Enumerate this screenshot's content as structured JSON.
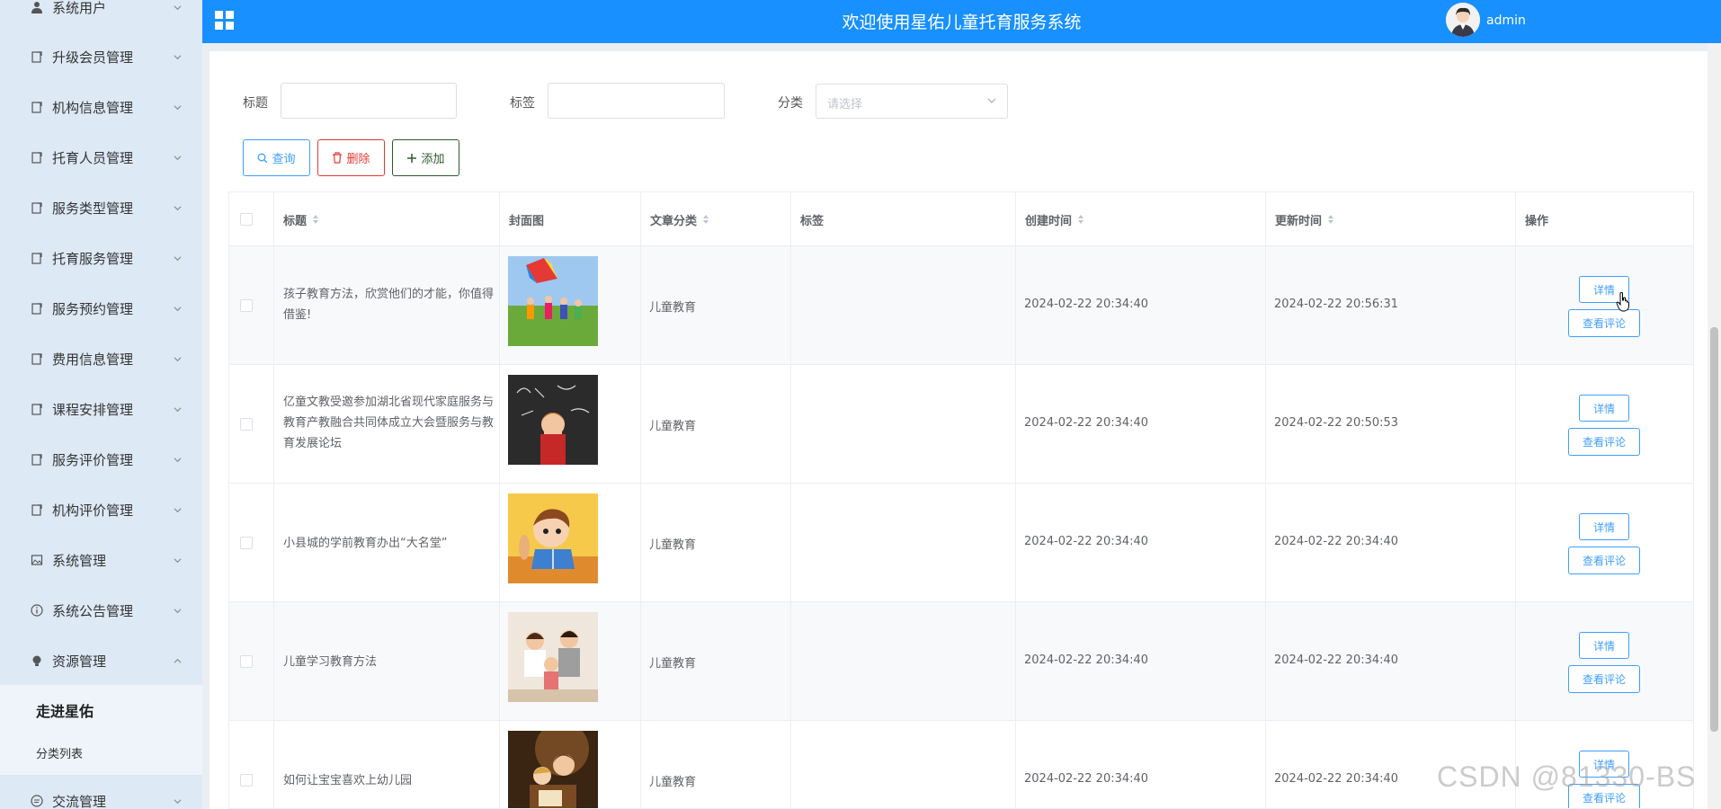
{
  "header": {
    "title": "欢迎使用星佑儿童托育服务系统",
    "user": "admin",
    "bg_color": "#1890ff"
  },
  "sidebar": {
    "items": [
      {
        "label": "系统用户",
        "icon": "user-icon",
        "expanded": false
      },
      {
        "label": "升级会员管理",
        "icon": "doc-icon",
        "expanded": false
      },
      {
        "label": "机构信息管理",
        "icon": "doc-icon",
        "expanded": false
      },
      {
        "label": "托育人员管理",
        "icon": "doc-icon",
        "expanded": false
      },
      {
        "label": "服务类型管理",
        "icon": "doc-icon",
        "expanded": false
      },
      {
        "label": "托育服务管理",
        "icon": "doc-icon",
        "expanded": false
      },
      {
        "label": "服务预约管理",
        "icon": "doc-icon",
        "expanded": false
      },
      {
        "label": "费用信息管理",
        "icon": "doc-icon",
        "expanded": false
      },
      {
        "label": "课程安排管理",
        "icon": "doc-icon",
        "expanded": false
      },
      {
        "label": "服务评价管理",
        "icon": "doc-icon",
        "expanded": false
      },
      {
        "label": "机构评价管理",
        "icon": "doc-icon",
        "expanded": false
      },
      {
        "label": "系统管理",
        "icon": "image-icon",
        "expanded": false
      },
      {
        "label": "系统公告管理",
        "icon": "info-icon",
        "expanded": false
      },
      {
        "label": "资源管理",
        "icon": "bulb-icon",
        "expanded": true
      },
      {
        "label": "交流管理",
        "icon": "chat-icon",
        "expanded": false
      }
    ],
    "submenu": {
      "active": "走进星佑",
      "other": "分类列表"
    }
  },
  "filters": {
    "title_label": "标题",
    "tag_label": "标签",
    "category_label": "分类",
    "title_value": "",
    "tag_value": "",
    "category_placeholder": "请选择"
  },
  "actions": {
    "query": "查询",
    "delete": "删除",
    "add": "添加"
  },
  "table": {
    "columns": {
      "title": "标题",
      "cover": "封面图",
      "category": "文章分类",
      "tags": "标签",
      "created": "创建时间",
      "updated": "更新时间",
      "ops": "操作"
    },
    "detail_label": "详情",
    "comment_label": "查看评论",
    "rows": [
      {
        "title": "孩子教育方法，欣赏他们的才能，你值得借鉴!",
        "category": "儿童教育",
        "tags": "",
        "created": "2024-02-22 20:34:40",
        "updated": "2024-02-22 20:56:31",
        "cover": "kids-kite"
      },
      {
        "title": "亿童文教受邀参加湖北省现代家庭服务与教育产教融合共同体成立大会暨服务与教育发展论坛",
        "category": "儿童教育",
        "tags": "",
        "created": "2024-02-22 20:34:40",
        "updated": "2024-02-22 20:50:53",
        "cover": "chalkboard-boy"
      },
      {
        "title": "小县城的学前教育办出“大名堂”",
        "category": "儿童教育",
        "tags": "",
        "created": "2024-02-22 20:34:40",
        "updated": "2024-02-22 20:34:40",
        "cover": "cartoon-reading"
      },
      {
        "title": "儿童学习教育方法",
        "category": "儿童教育",
        "tags": "",
        "created": "2024-02-22 20:34:40",
        "updated": "2024-02-22 20:34:40",
        "cover": "family"
      },
      {
        "title": "如何让宝宝喜欢上幼儿园",
        "category": "儿童教育",
        "tags": "",
        "created": "2024-02-22 20:34:40",
        "updated": "2024-02-22 20:34:40",
        "cover": "reading-night"
      }
    ]
  },
  "watermark": "CSDN @81330-BS"
}
